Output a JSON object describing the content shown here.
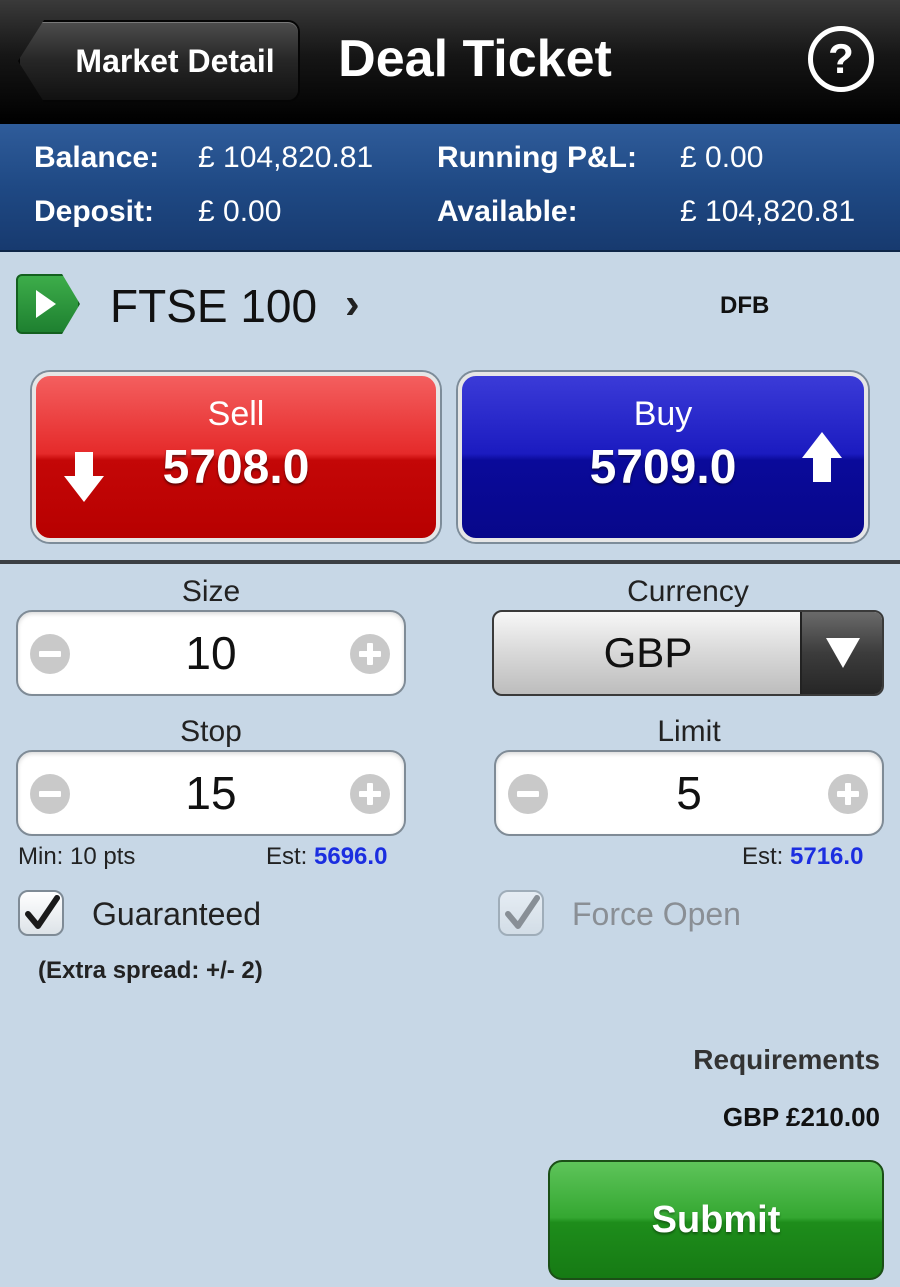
{
  "nav": {
    "back_label": "Market Detail",
    "title": "Deal Ticket",
    "help_symbol": "?"
  },
  "account": {
    "balance_label": "Balance:",
    "balance_value": "£ 104,820.81",
    "running_pl_label": "Running P&L:",
    "running_pl_value": "£ 0.00",
    "deposit_label": "Deposit:",
    "deposit_value": "£ 0.00",
    "available_label": "Available:",
    "available_value": "£ 104,820.81"
  },
  "market": {
    "name": "FTSE 100",
    "chevron": "›",
    "product_type": "DFB"
  },
  "deal": {
    "sell_label": "Sell",
    "sell_price": "5708.0",
    "buy_label": "Buy",
    "buy_price": "5709.0"
  },
  "form": {
    "size_label": "Size",
    "size_value": "10",
    "currency_label": "Currency",
    "currency_value": "GBP",
    "stop_label": "Stop",
    "stop_value": "15",
    "limit_label": "Limit",
    "limit_value": "5",
    "stop_min": "Min: 10 pts",
    "est_label": "Est:",
    "stop_est_value": "5696.0",
    "limit_est_value": "5716.0",
    "guaranteed_label": "Guaranteed",
    "guaranteed_checked": true,
    "extra_spread": "(Extra spread: +/- 2)",
    "force_open_label": "Force Open",
    "force_open_checked": true
  },
  "requirements": {
    "label": "Requirements",
    "value": "GBP £210.00"
  },
  "submit_label": "Submit",
  "colors": {
    "sell": "#d61414",
    "buy": "#0d0da8",
    "submit": "#2a9a27",
    "est_value": "#1b2ee0",
    "account_bar": "#1f4984",
    "background": "#c7d7e6"
  }
}
